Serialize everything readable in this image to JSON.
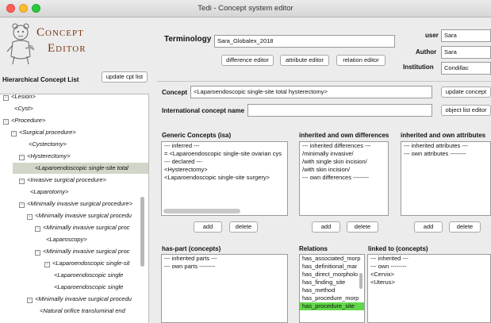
{
  "window": {
    "title": "Tedi - Concept system editor"
  },
  "logo": {
    "line1": "Concept",
    "line2": "Editor"
  },
  "left": {
    "heading": "Hierarchical Concept List",
    "update_btn": "update cpt list",
    "tree": [
      {
        "toggle": "⊟",
        "label": "<Lesion>"
      },
      {
        "toggle": "",
        "label": "<Cyst>"
      },
      {
        "toggle": "⊟",
        "label": "<Procedure>"
      },
      {
        "toggle": "⊟",
        "label": "<Surgical procedure>"
      },
      {
        "toggle": "",
        "label": "<Cystectomy>"
      },
      {
        "toggle": "⊟",
        "label": "<Hysterectomy>"
      },
      {
        "toggle": "",
        "label": "<Laparoendoscopic single-site total"
      },
      {
        "toggle": "⊟",
        "label": "<Invasive surgical procedure>"
      },
      {
        "toggle": "",
        "label": "<Laparotomy>"
      },
      {
        "toggle": "⊟",
        "label": "<Minimally invasive surgical procedure>"
      },
      {
        "toggle": "⊟",
        "label": "<Minimally invasive surgical procedu"
      },
      {
        "toggle": "⊟",
        "label": "<Minimally invasive surgical proc"
      },
      {
        "toggle": "",
        "label": "<Laparoscopy>"
      },
      {
        "toggle": "⊟",
        "label": "<Minimally invasive surgical proc"
      },
      {
        "toggle": "⊟",
        "label": "<Laparoendoscopic single-sit"
      },
      {
        "toggle": "",
        "label": "<Laparoendoscopic single"
      },
      {
        "toggle": "",
        "label": "<Laparoendoscopic single"
      },
      {
        "toggle": "⊟",
        "label": "<Minimally invasive surgical procedu"
      },
      {
        "toggle": "",
        "label": "<Natural orifice transluminal end"
      }
    ]
  },
  "terminology": {
    "label": "Terminology",
    "value": "Sara_Globalex_2018",
    "diff_btn": "difference editor",
    "attr_btn": "attribute editor",
    "rel_btn": "relation editor"
  },
  "meta": {
    "user_label": "user",
    "user_value": "Sara",
    "author_label": "Author",
    "author_value": "Sara",
    "inst_label": "Institution",
    "inst_value": "Condillac"
  },
  "concept": {
    "label": "Concept",
    "value": "<Laparoendoscopic single-site total hysterectomy>",
    "update_btn": "update concept",
    "intl_label": "International concept name",
    "intl_value": "",
    "object_btn": "object list editor"
  },
  "generic": {
    "heading": "Generic Concepts (isa)",
    "lines": [
      "--- inferred ---",
      "= <Laparoendoscopic single-site ovarian cys",
      "--- declared ---",
      "<Hysterectomy>",
      "<Laparoendoscopic single-site surgery>"
    ],
    "add": "add",
    "delete": "delete"
  },
  "differences": {
    "heading": "inherited and own differences",
    "lines": [
      "--- inherited differences ---",
      "/minimally invasive/",
      "/with single skin incision/",
      "/with skin incision/",
      "--- own differences --------"
    ],
    "add": "add",
    "delete": "delete"
  },
  "attributes": {
    "heading": "inherited and own attributes",
    "lines": [
      "--- inherited attributes ---",
      "--- own attributes --------"
    ],
    "add": "add",
    "delete": "delete"
  },
  "haspart": {
    "heading": "has-part (concepts)",
    "lines": [
      "--- inherited parts ---",
      "--- own parts --------"
    ]
  },
  "relations": {
    "heading": "Relations",
    "items": [
      "has_associated_morp",
      "has_definitional_mar",
      "has_direct_morpholo",
      "has_finding_site",
      "has_method",
      "has_procedure_morp",
      "has_procedure_site"
    ],
    "selected_index": 6,
    "selected_color": "#62d74a"
  },
  "linked": {
    "heading": "linked to (concepts)",
    "lines": [
      "--- inherited ---",
      "--- own --------",
      "<Cervix>",
      "<Uterus>"
    ]
  }
}
